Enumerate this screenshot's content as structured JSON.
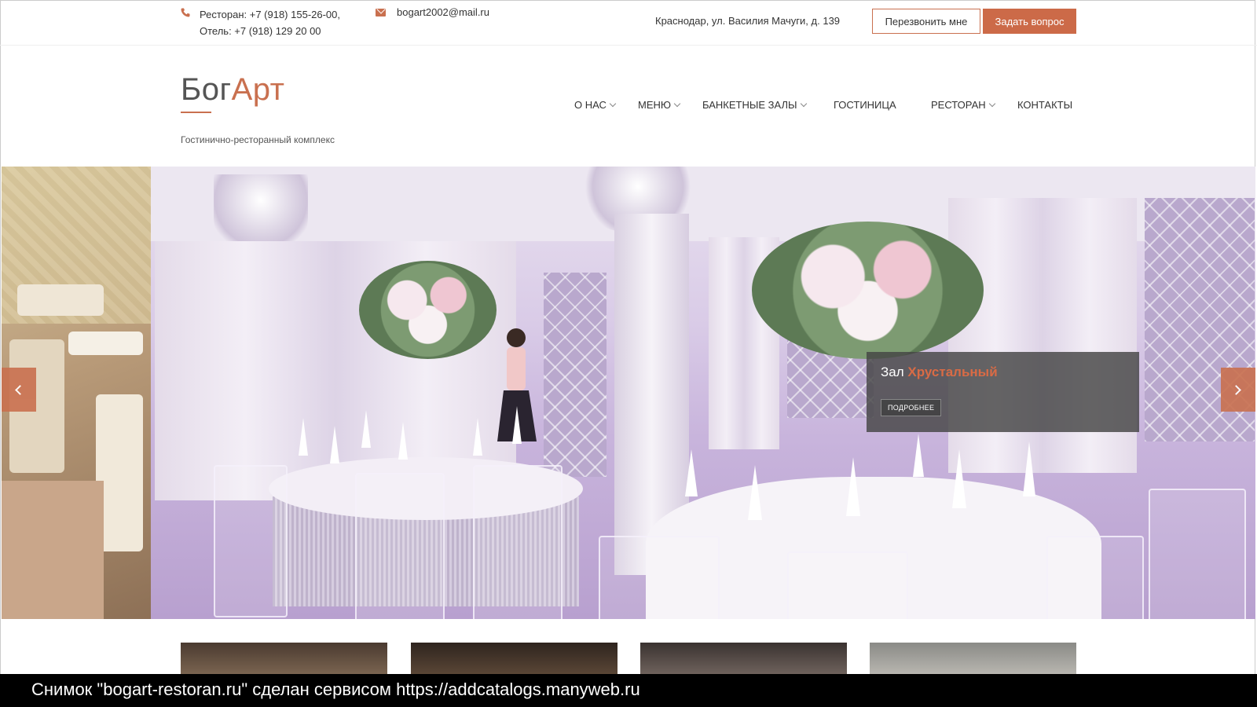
{
  "topbar": {
    "phone_icon": "phone-icon",
    "phone_line1": "Ресторан: +7 (918) 155-26-00,",
    "phone_line2": "Отель: +7 (918) 129 20 00",
    "mail_icon": "envelope-icon",
    "email": "bogart2002@mail.ru",
    "address": "Краснодар, ул. Василия Мачуги, д. 139",
    "callback_label": "Перезвонить мне",
    "ask_label": "Задать вопрос"
  },
  "header": {
    "logo_part1": "Бог",
    "logo_part2": "Арт",
    "tagline": "Гостинично-ресторанный комплекс"
  },
  "nav": {
    "items": [
      {
        "label": "О НАС",
        "has_submenu": true
      },
      {
        "label": "МЕНЮ",
        "has_submenu": true
      },
      {
        "label": "БАНКЕТНЫЕ ЗАЛЫ",
        "has_submenu": true
      },
      {
        "label": "ГОСТИНИЦА",
        "has_submenu": false
      },
      {
        "label": "РЕСТОРАН",
        "has_submenu": true
      },
      {
        "label": "КОНТАКТЫ",
        "has_submenu": false
      }
    ]
  },
  "slider": {
    "caption_prefix": "Зал",
    "caption_highlight": "Хрустальный",
    "more_label": "ПОДРОБНЕЕ",
    "prev_icon": "chevron-left-icon",
    "next_icon": "chevron-right-icon"
  },
  "footer_strip": {
    "text": "Снимок \"bogart-restoran.ru\" сделан сервисом https://addcatalogs.manyweb.ru"
  },
  "colors": {
    "accent": "#cc6a48",
    "caption_highlight": "#d96b45",
    "caption_bg": "#444444",
    "strip_bg": "#000000"
  }
}
